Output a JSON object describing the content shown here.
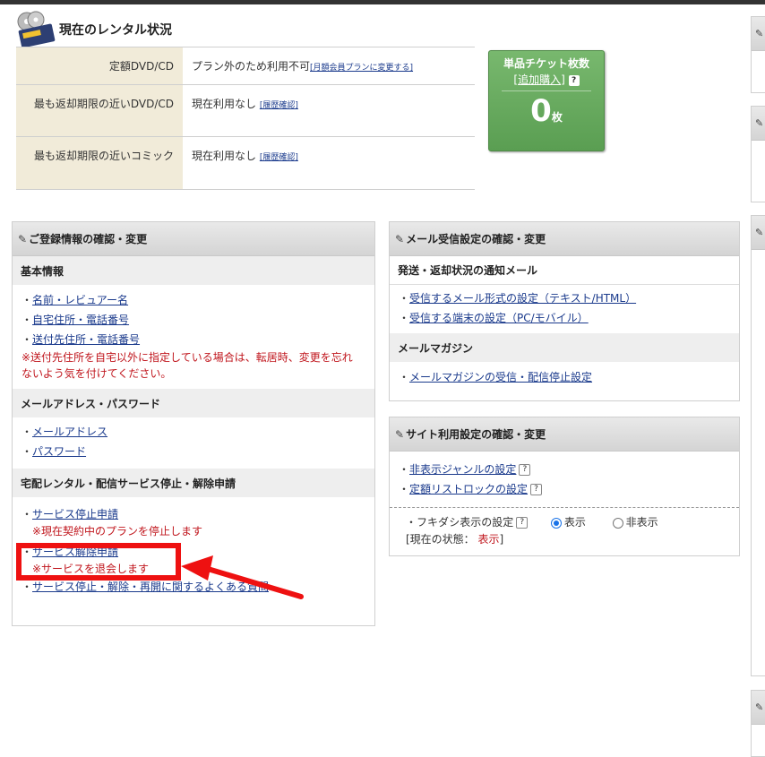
{
  "rental": {
    "title": "現在のレンタル状況",
    "rows": [
      {
        "label": "定額DVD/CD",
        "value": "プラン外のため利用不可",
        "link": "[月額会員プランに変更する]"
      },
      {
        "label": "最も返却期限の近いDVD/CD",
        "value": "現在利用なし",
        "link": "[履歴確認]"
      },
      {
        "label": "最も返却期限の近いコミック",
        "value": "現在利用なし",
        "link": "[履歴確認]"
      }
    ]
  },
  "ticket": {
    "title": "単品チケット枚数",
    "add_open": "[",
    "add_label": "追加購入",
    "add_close": "]",
    "help": "?",
    "count": "0",
    "unit": "枚"
  },
  "registration": {
    "title": "ご登録情報の確認・変更",
    "basic": {
      "title": "基本情報",
      "items": [
        "名前・レビュアー名",
        "自宅住所・電話番号",
        "送付先住所・電話番号"
      ],
      "note": "※送付先住所を自宅以外に指定している場合は、転居時、変更を忘れないよう気を付けてください。"
    },
    "mail_pw": {
      "title": "メールアドレス・パスワード",
      "items": [
        "メールアドレス",
        "パスワード"
      ]
    },
    "service": {
      "title": "宅配レンタル・配信サービス停止・解除申請",
      "stop": "サービス停止申請",
      "stop_note": "※現在契約中のプランを停止します",
      "cancel": "サービス解除申請",
      "cancel_note": "※サービスを退会します",
      "faq": "サービス停止・解除・再開に関するよくある質問"
    }
  },
  "mail_settings": {
    "title": "メール受信設定の確認・変更",
    "notify": {
      "title": "発送・返却状況の通知メール",
      "items": [
        "受信するメール形式の設定（テキスト/HTML）",
        "受信する端末の設定（PC/モバイル）"
      ]
    },
    "magazine": {
      "title": "メールマガジン",
      "items": [
        "メールマガジンの受信・配信停止設定"
      ]
    }
  },
  "site_settings": {
    "title": "サイト利用設定の確認・変更",
    "items": [
      "非表示ジャンルの設定",
      "定額リストロックの設定"
    ],
    "help": "?",
    "fukidashi_label": "・フキダシ表示の設定",
    "option_show": "表示",
    "option_hide": "非表示",
    "status_prefix": "[現在の状態：",
    "status_value": "表示",
    "status_suffix": "]"
  },
  "colors": {
    "accent_red": "#ee1111",
    "ticket_green": "#6aaa5f",
    "link_blue": "#1a3a8c",
    "note_red": "#c0161d"
  }
}
